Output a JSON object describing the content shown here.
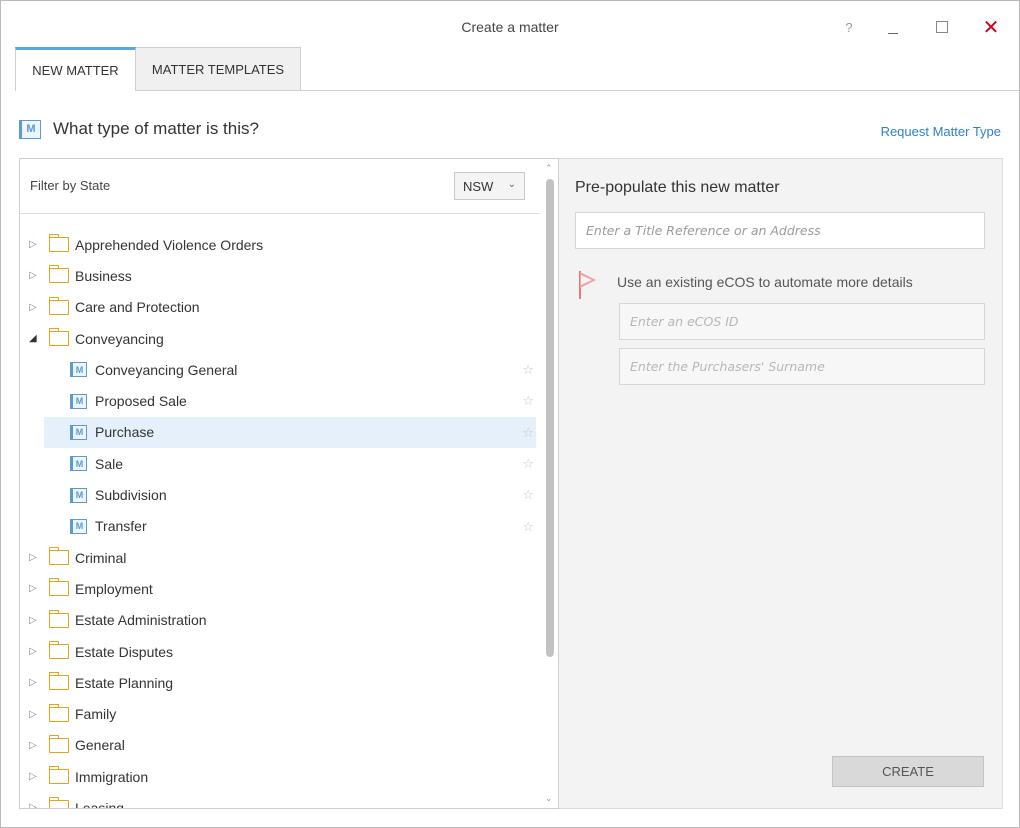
{
  "window": {
    "title": "Create a matter",
    "help_label": "?",
    "close_label": "✕"
  },
  "tabs": [
    {
      "label": "NEW MATTER",
      "active": true
    },
    {
      "label": "MATTER TEMPLATES",
      "active": false
    }
  ],
  "header": {
    "question": "What type of matter is this?",
    "request_link": "Request Matter Type",
    "matter_icon_letter": "M"
  },
  "filter": {
    "label": "Filter by State",
    "selected_state": "NSW"
  },
  "tree": {
    "categories": [
      "Apprehended Violence Orders",
      "Business",
      "Care and Protection",
      "Conveyancing",
      "Criminal",
      "Employment",
      "Estate Administration",
      "Estate Disputes",
      "Estate Planning",
      "Family",
      "General",
      "Immigration",
      "Leasing"
    ],
    "expanded_category": "Conveyancing",
    "conveyancing_children": [
      "Conveyancing General",
      "Proposed Sale",
      "Purchase",
      "Sale",
      "Subdivision",
      "Transfer"
    ],
    "selected_child": "Purchase"
  },
  "prepopulate": {
    "title": "Pre-populate this new matter",
    "title_ref_placeholder": "Enter a Title Reference or an Address",
    "ecos_label": "Use an existing eCOS to automate more details",
    "ecos_id_placeholder": "Enter an eCOS ID",
    "surname_placeholder": "Enter the Purchasers' Surname",
    "create_label": "CREATE"
  },
  "colors": {
    "accent": "#2f80c8",
    "folder": "#e8a316",
    "selected_row": "#e5f0fb",
    "close": "#d0021b"
  }
}
